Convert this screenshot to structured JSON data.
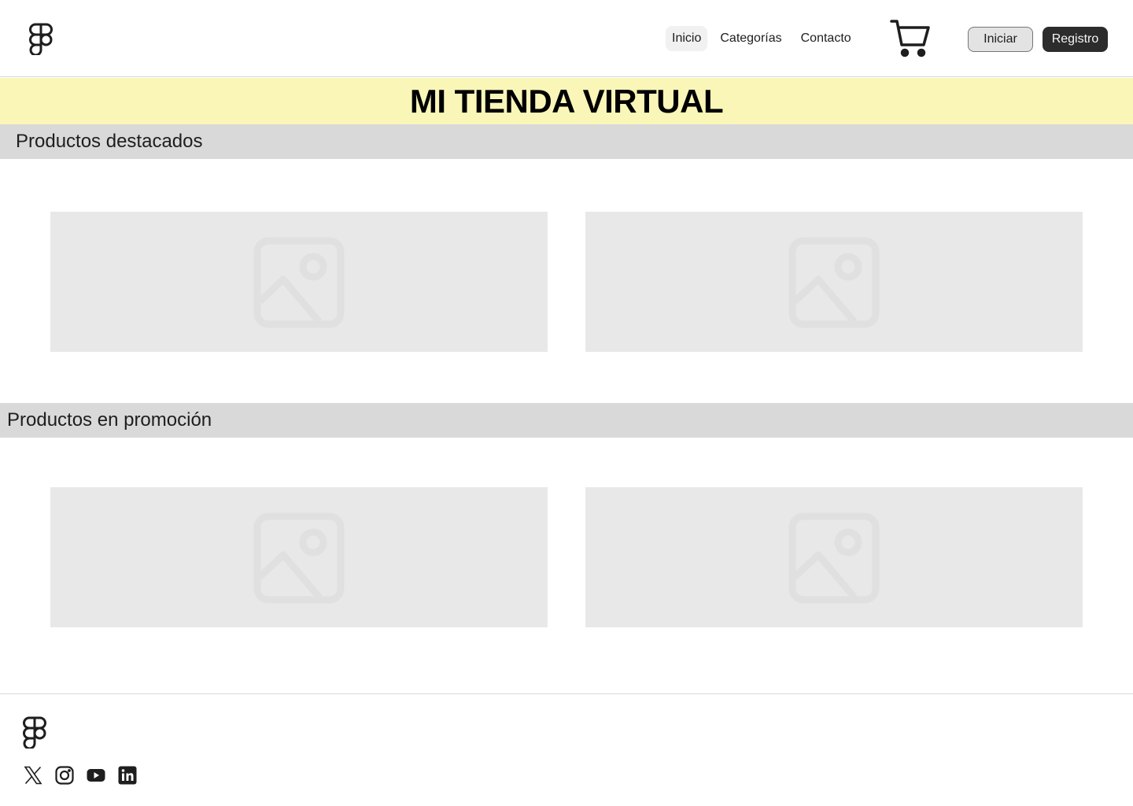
{
  "header": {
    "logo_icon": "figma-logo-icon",
    "nav": [
      {
        "label": "Inicio",
        "active": true
      },
      {
        "label": "Categorías",
        "active": false
      },
      {
        "label": "Contacto",
        "active": false
      }
    ],
    "cart_icon": "shopping-cart-icon",
    "signin_label": "Iniciar",
    "register_label": "Registro"
  },
  "banner": {
    "title": "MI TIENDA VIRTUAL",
    "background": "#faf6b8"
  },
  "sections": [
    {
      "title": "Productos destacados",
      "images": [
        "image-placeholder-icon",
        "image-placeholder-icon"
      ]
    },
    {
      "title": "Productos en promoción",
      "images": [
        "image-placeholder-icon",
        "image-placeholder-icon"
      ]
    }
  ],
  "footer": {
    "logo_icon": "figma-logo-icon",
    "social": [
      "x-icon",
      "instagram-icon",
      "youtube-icon",
      "linkedin-icon"
    ]
  },
  "colors": {
    "accent_dark": "#2c2c2c",
    "section_bar": "#d9d9d9",
    "placeholder": "#e8e8e8"
  }
}
